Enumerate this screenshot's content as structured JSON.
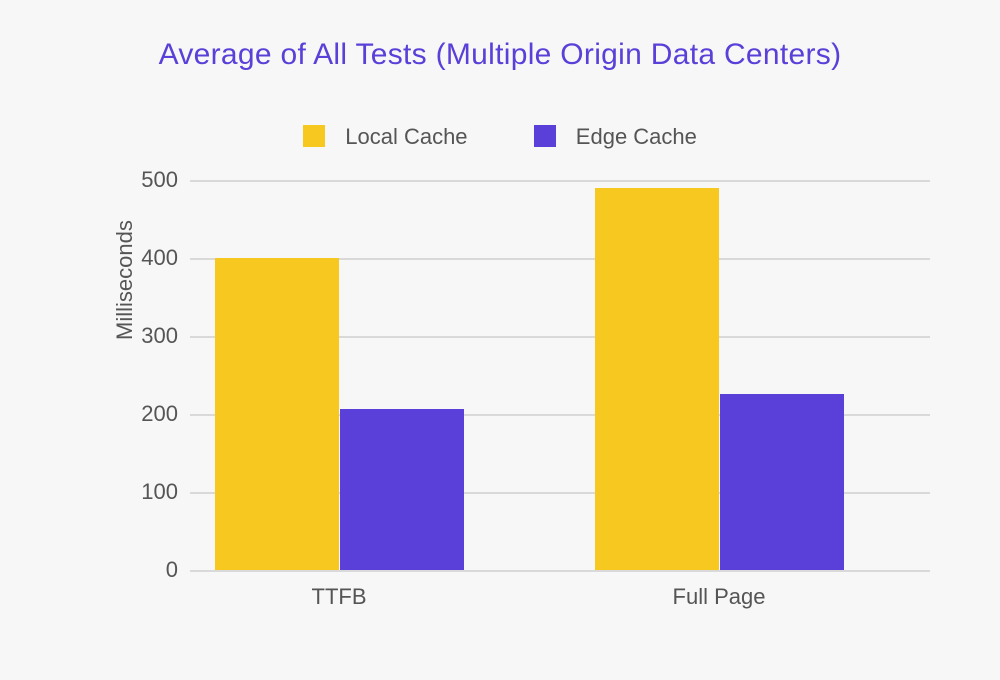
{
  "chart_data": {
    "type": "bar",
    "title": "Average of All Tests (Multiple Origin Data Centers)",
    "ylabel": "Milliseconds",
    "xlabel": "",
    "categories": [
      "TTFB",
      "Full Page"
    ],
    "series": [
      {
        "name": "Local Cache",
        "values": [
          400,
          490
        ],
        "color": "#f7c820"
      },
      {
        "name": "Edge Cache",
        "values": [
          207,
          225
        ],
        "color": "#5a3fd9"
      }
    ],
    "yticks": [
      0,
      100,
      200,
      300,
      400,
      500
    ],
    "ylim": [
      0,
      500
    ],
    "legend_position": "top",
    "grid": true
  }
}
